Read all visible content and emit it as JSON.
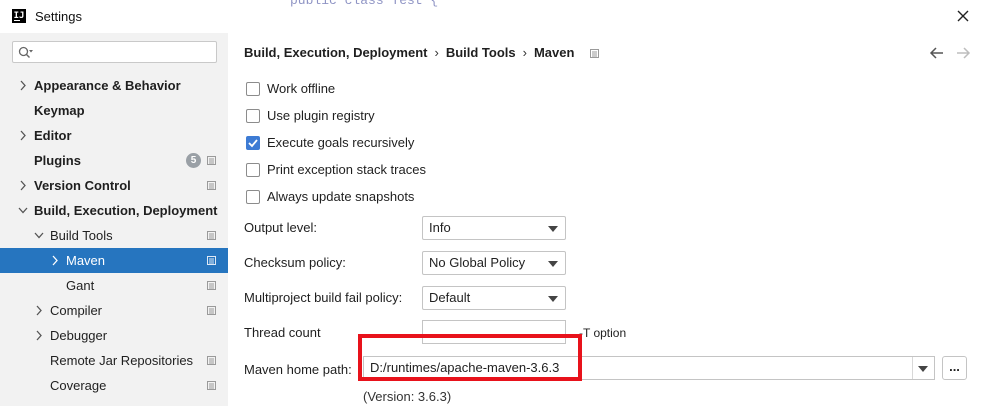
{
  "window": {
    "title": "Settings"
  },
  "background_code": "public class Test {",
  "search": {
    "placeholder": ""
  },
  "sidebar": {
    "items": [
      {
        "label": "Appearance & Behavior"
      },
      {
        "label": "Keymap"
      },
      {
        "label": "Editor"
      },
      {
        "label": "Plugins",
        "badge": "5"
      },
      {
        "label": "Version Control"
      },
      {
        "label": "Build, Execution, Deployment"
      },
      {
        "label": "Build Tools"
      },
      {
        "label": "Maven"
      },
      {
        "label": "Gant"
      },
      {
        "label": "Compiler"
      },
      {
        "label": "Debugger"
      },
      {
        "label": "Remote Jar Repositories"
      },
      {
        "label": "Coverage"
      }
    ]
  },
  "breadcrumb": {
    "items": [
      "Build, Execution, Deployment",
      "Build Tools",
      "Maven"
    ],
    "separator": "›"
  },
  "options": [
    {
      "label": "Work offline",
      "checked": false
    },
    {
      "label": "Use plugin registry",
      "checked": false
    },
    {
      "label": "Execute goals recursively",
      "checked": true
    },
    {
      "label": "Print exception stack traces",
      "checked": false
    },
    {
      "label": "Always update snapshots",
      "checked": false
    }
  ],
  "fields": {
    "output_level": {
      "label": "Output level:",
      "value": "Info"
    },
    "checksum_policy": {
      "label": "Checksum policy:",
      "value": "No Global Policy"
    },
    "fail_policy": {
      "label": "Multiproject build fail policy:",
      "value": "Default"
    },
    "thread_count": {
      "label": "Thread count",
      "value": "",
      "hint": "-T option"
    },
    "maven_home": {
      "label": "Maven home path:",
      "value": "D:/runtimes/apache-maven-3.6.3",
      "browse": "...",
      "version": "(Version: 3.6.3)"
    }
  },
  "colors": {
    "selection": "#2675bf",
    "highlight_border": "#e8121b",
    "checkbox_checked": "#3d7bd4"
  }
}
